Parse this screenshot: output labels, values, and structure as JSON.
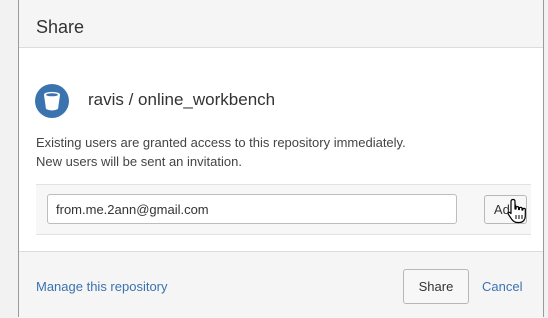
{
  "dialog": {
    "title": "Share",
    "repository": {
      "name": "ravis / online_workbench",
      "icon": "repository-icon"
    },
    "description": [
      "Existing users are granted access to this repository immediately.",
      "New users will be sent an invitation."
    ],
    "email_input": {
      "value": "from.me.2ann@gmail.com",
      "placeholder": ""
    },
    "add_label": "Add",
    "footer": {
      "manage_link": "Manage this repository",
      "share_label": "Share",
      "cancel_label": "Cancel"
    }
  },
  "colors": {
    "link": "#3b73af",
    "repo_icon": "#3b73af"
  }
}
